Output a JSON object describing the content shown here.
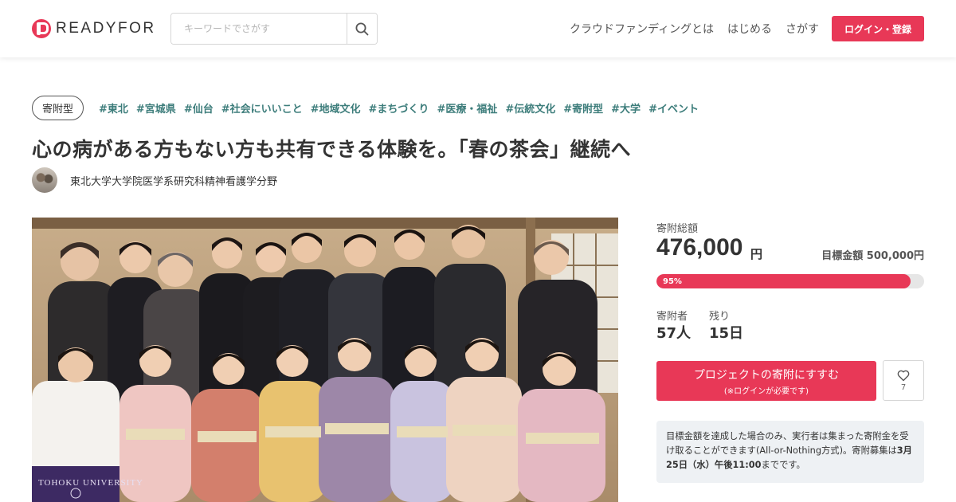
{
  "header": {
    "logo_text": "READYFOR",
    "search_placeholder": "キーワードでさがす",
    "nav": [
      "クラウドファンディングとは",
      "はじめる",
      "さがす"
    ],
    "login_label": "ログイン・登録"
  },
  "project": {
    "type_badge": "寄附型",
    "tags": [
      "#東北",
      "#宮城県",
      "#仙台",
      "#社会にいいこと",
      "#地域文化",
      "#まちづくり",
      "#医療・福祉",
      "#伝統文化",
      "#寄附型",
      "#大学",
      "#イベント"
    ],
    "title": "心の病がある方もない方も共有できる体験を。「春の茶会」継続へ",
    "owner_name": "東北大学大学院医学系研究科精神看護学分野",
    "photo_caption": "TOHOKU UNIVERSITY"
  },
  "stats": {
    "total_label": "寄附総額",
    "total_value": "476,000",
    "total_unit": "円",
    "goal_text": "目標金額 500,000円",
    "progress_percent": 95,
    "progress_label": "95%",
    "supporters_label": "寄附者",
    "supporters_value": "57人",
    "remaining_label": "残り",
    "remaining_value": "15日"
  },
  "actions": {
    "donate_label": "プロジェクトの寄附にすすむ",
    "donate_sub": "(※ログインが必要です)",
    "favorite_count": "7"
  },
  "note": {
    "text_pre": "目標金額を達成した場合のみ、実行者は集まった寄附金を受け取ることができます(All-or-Nothing方式)。寄附募集は",
    "deadline": "3月25日（水）午後11:00",
    "text_post": "までです。"
  },
  "colors": {
    "brand": "#e83857",
    "tag": "#3d7d7b",
    "note_bg": "#eef1f4"
  },
  "icons": {
    "search": "search-icon",
    "favorite": "heart-icon"
  }
}
